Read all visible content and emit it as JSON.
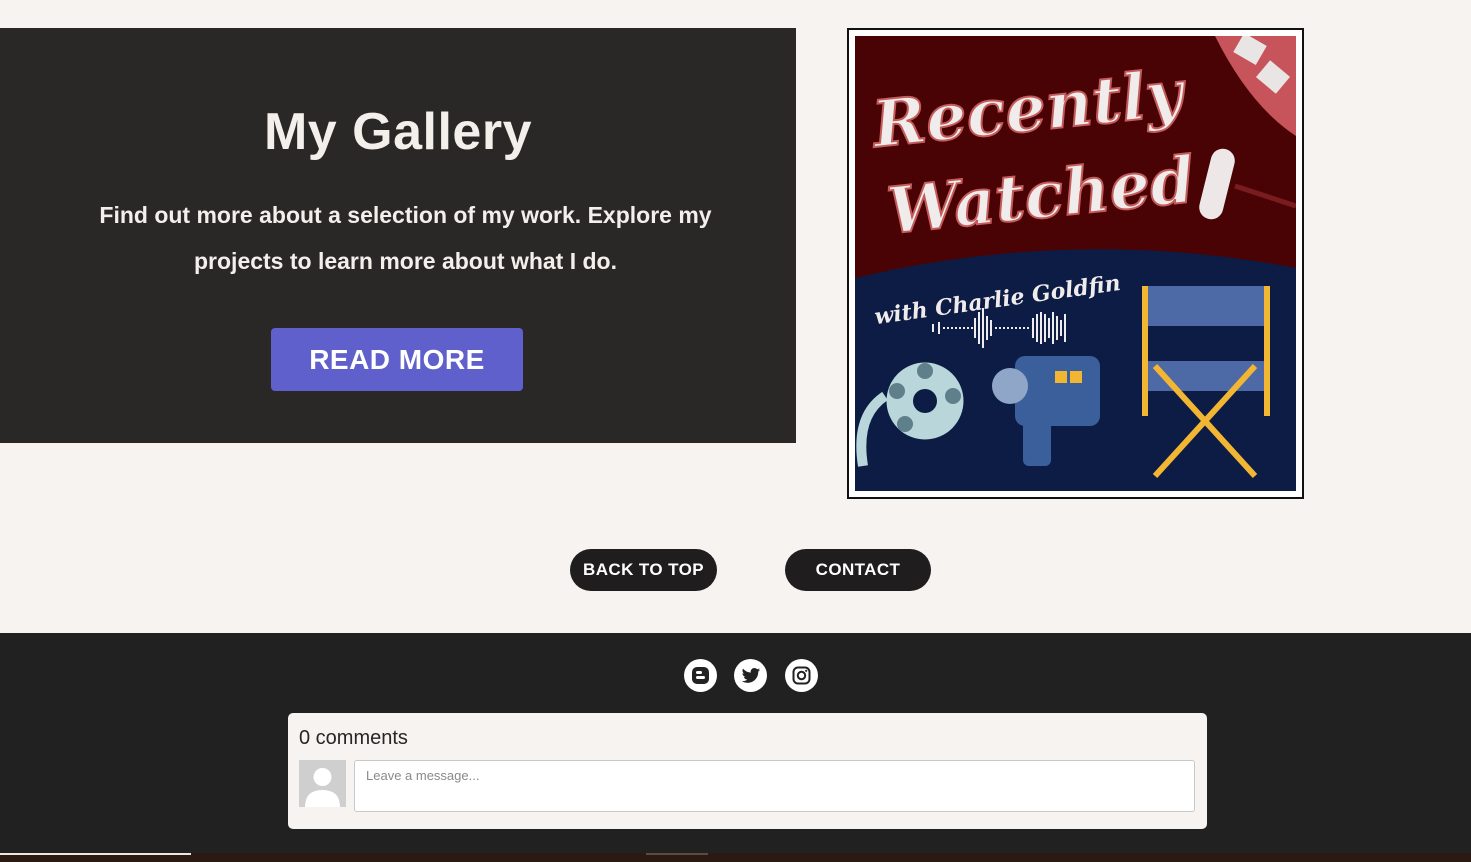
{
  "hero": {
    "title": "My Gallery",
    "description": "Find out more about a selection of my work. Explore my projects to learn more about what I do.",
    "button_label": "READ MORE",
    "button_color": "#6060cc",
    "background_color": "#2a2727"
  },
  "artwork": {
    "title_line1": "Recently",
    "title_line2": "Watched",
    "subtitle": "with Charlie Goldfin",
    "colors": {
      "top": "#4a0304",
      "bottom": "#0c1c45",
      "accent": "#f2b633"
    }
  },
  "nav": {
    "back_to_top": "BACK TO TOP",
    "contact": "CONTACT"
  },
  "social": [
    {
      "icon": "blogger-icon"
    },
    {
      "icon": "twitter-icon"
    },
    {
      "icon": "instagram-icon"
    }
  ],
  "comments": {
    "count_label": "0 comments",
    "placeholder": "Leave a message..."
  }
}
